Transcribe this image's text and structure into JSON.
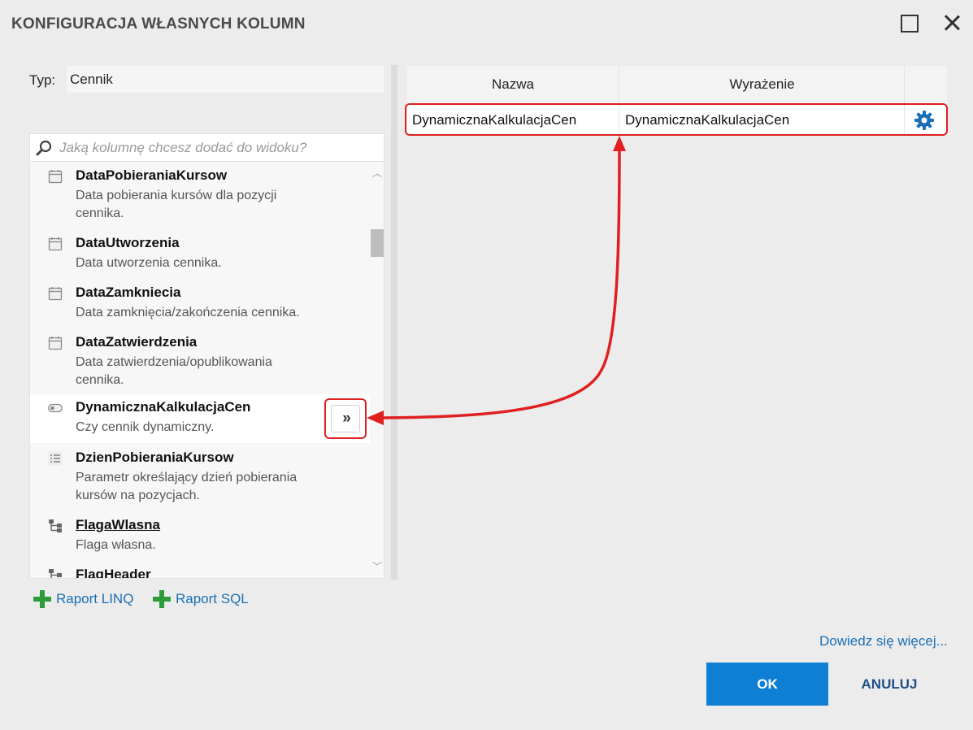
{
  "window": {
    "title": "KONFIGURACJA WŁASNYCH KOLUMN"
  },
  "type_field": {
    "label": "Typ:",
    "value": "Cennik"
  },
  "search": {
    "placeholder": "Jaką kolumnę chcesz dodać do widoku?",
    "value": ""
  },
  "columns_list": {
    "items": [
      {
        "name": "DataPobieraniaKursow",
        "description": "Data pobierania kursów dla pozycji cennika.",
        "icon": "calendar-icon"
      },
      {
        "name": "DataUtworzenia",
        "description": "Data utworzenia cennika.",
        "icon": "calendar-icon"
      },
      {
        "name": "DataZamkniecia",
        "description": "Data zamknięcia/zakończenia cennika.",
        "icon": "calendar-icon"
      },
      {
        "name": "DataZatwierdzenia",
        "description": "Data zatwierdzenia/opublikowania cennika.",
        "icon": "calendar-icon"
      },
      {
        "name": "DynamicznaKalkulacjaCen",
        "description": "Czy cennik dynamiczny.",
        "icon": "toggle-icon"
      },
      {
        "name": "DzienPobieraniaKursow",
        "description": "Parametr określający dzień pobierania kursów na pozycjach.",
        "icon": "list-icon"
      },
      {
        "name": "FlagaWlasna",
        "description": "Flaga własna.",
        "icon": "hierarchy-icon"
      },
      {
        "name": "FlagHeader",
        "description": "",
        "icon": "hierarchy-icon"
      }
    ],
    "add_button_label": "»"
  },
  "grid": {
    "headers": {
      "name": "Nazwa",
      "expression": "Wyrażenie"
    },
    "rows": [
      {
        "name": "DynamicznaKalkulacjaCen",
        "expression": "DynamicznaKalkulacjaCen"
      }
    ]
  },
  "actions": {
    "raport_linq": "Raport LINQ",
    "raport_sql": "Raport SQL",
    "learn_more": "Dowiedz się więcej...",
    "ok": "OK",
    "cancel": "ANULUJ"
  },
  "colors": {
    "accent": "#0f7fd4",
    "link": "#1a6fb5",
    "highlight": "#e02020",
    "plus": "#2e9b3a"
  }
}
